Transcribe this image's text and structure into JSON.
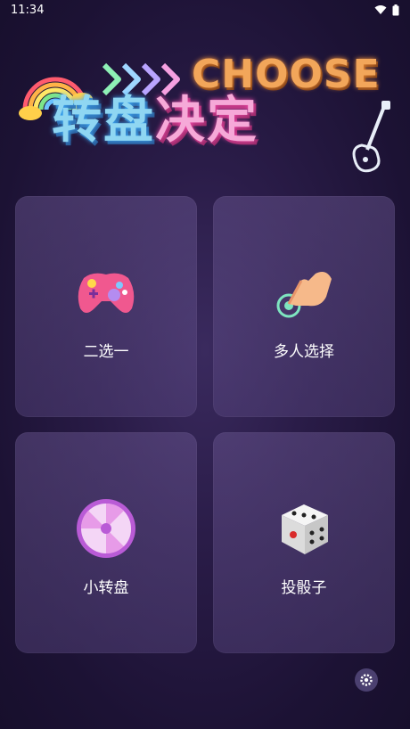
{
  "status_bar": {
    "time": "11:34",
    "icons": [
      "wifi-icon",
      "battery-icon"
    ]
  },
  "header": {
    "title_en": "CHOOSE",
    "title_cn_part1": "转盘",
    "title_cn_part2": "决定",
    "decorations": [
      "rainbow-icon",
      "arrows-icon",
      "guitar-icon"
    ]
  },
  "menu": {
    "items": [
      {
        "label": "二选一",
        "icon": "gamepad-icon"
      },
      {
        "label": "多人选择",
        "icon": "hand-tap-icon"
      },
      {
        "label": "小转盘",
        "icon": "wheel-icon"
      },
      {
        "label": "投骰子",
        "icon": "dice-icon"
      }
    ]
  },
  "footer": {
    "settings_icon": "settings-icon"
  },
  "colors": {
    "background": "#1c1234",
    "card": "#5a4882",
    "title_blue": "#8fd6f2",
    "title_pink": "#f6a9d8",
    "title_orange": "#f2a65a"
  }
}
